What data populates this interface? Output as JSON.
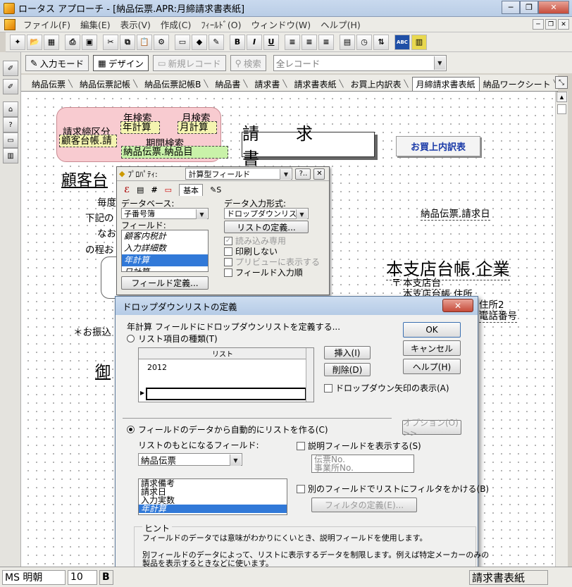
{
  "window": {
    "title": "ロータス アプローチ - [納品伝票.APR:月締請求書表紙]",
    "minimize": "─",
    "restore": "❐",
    "close": "✕"
  },
  "menu": [
    "ファイル(F)",
    "編集(E)",
    "表示(V)",
    "作成(C)",
    "ﾌｨｰﾙﾄﾞ(O)",
    "ウィンドウ(W)",
    "ヘルプ(H)"
  ],
  "toolbar": {
    "bold": "B",
    "italic": "I",
    "underline": "U"
  },
  "modebar": {
    "input_mode": "入力モード",
    "design": "デザイン",
    "new_record": "新規レコード",
    "search": "検索",
    "record_filter": "全レコード"
  },
  "tabs": [
    "納品伝票",
    "納品伝票記帳",
    "納品伝票記帳B",
    "納品書",
    "請求書",
    "請求書表紙",
    "お買上内訳表",
    "月締請求書表紙",
    "納品ワークシート",
    "顧"
  ],
  "active_tab_index": 7,
  "form": {
    "year_search_label": "年検索",
    "month_search_label": "月検索",
    "year_calc_field": "年計算",
    "month_calc_field": "月計算",
    "billing_closing_label": "請求締区分",
    "customer_field": "顧客台帳.請",
    "period_search_label": "期間検索",
    "delivery_item_field": "納品伝票.納品目",
    "invoice_title": "請　求　書",
    "monthly_breakdown_button": "お買上内訳表",
    "customer_name_partial": "顧客台",
    "text_line1": "毎度",
    "text_line2": "下記の",
    "text_line3": "なお",
    "text_line4": "の程お",
    "invoice_date_field": "納品伝票.請求日",
    "branch_company_field": "本支店台帳.企業",
    "postal_mark": "〒",
    "branch_field": "本支店台",
    "address_field": "本支店台帳.住所",
    "address2_field": "住所2",
    "phone_field": "電話番号",
    "transfer_note": "＊お振込",
    "honorific_partial": "御"
  },
  "properties": {
    "title": "ﾌﾟﾛﾊﾟﾃｨ:",
    "field_type": "計算型フィールド",
    "help_btn": "?..",
    "close_btn": "✕",
    "tab_basic": "基本",
    "database_label": "データベース:",
    "database_value": "子番号簿",
    "input_format_label": "データ入力形式:",
    "input_format_value": "ドロップダウンリスト",
    "fields_label": "フィールド:",
    "fields": [
      "顧客内税計",
      "入力詳細数",
      "年計算",
      "日計算"
    ],
    "selected_field_index": 2,
    "list_define_btn": "リストの定義...",
    "field_define_btn": "フィールド定義...",
    "opt_readonly": "読み込み専用",
    "opt_noprint": "印刷しない",
    "opt_preview": "プリビューに表示する",
    "opt_entry_order": "フィールド入力順"
  },
  "dialog": {
    "title": "ドロップダウンリストの定義",
    "close": "✕",
    "description": "年計算 フィールドにドロップダウンリストを定義する...",
    "radio_list_items": "リスト項目の種類(T)",
    "grid_header": "リスト",
    "grid_values": [
      "2012",
      ""
    ],
    "insert_btn": "挿入(I)",
    "delete_btn": "削除(D)",
    "ok_btn": "OK",
    "cancel_btn": "キャンセル",
    "help_btn": "ヘルプ(H)",
    "show_arrow_check": "ドロップダウン矢印の表示(A)",
    "radio_auto": "フィールドのデータから自動的にリストを作る(C)",
    "options_btn": "オプション(O) >>",
    "base_field_label": "リストのもとになるフィールド:",
    "base_table": "納品伝票",
    "base_fields": [
      "請求備考",
      "請求日",
      "入力実数",
      "年計算"
    ],
    "selected_base_field_index": 3,
    "show_desc_check": "説明フィールドを表示する(S)",
    "desc_fields": [
      "伝票No.",
      "事業所No."
    ],
    "filter_check": "別のフィールドでリストにフィルタをかける(B)",
    "filter_btn": "フィルタの定義(E)...",
    "hint_label": "ヒント",
    "hint1": "フィールドのデータでは意味がわかりにくいとき、説明フィールドを使用します。",
    "hint2": "別フィールドのデータによって、リストに表示するデータを制限します。例えば特定メーカーのみの",
    "hint3": "製品を表示するときなどに使います。"
  },
  "statusbar": {
    "font": "MS 明朝",
    "size": "10",
    "bold": "B",
    "layout_name": "請求書表紙"
  }
}
